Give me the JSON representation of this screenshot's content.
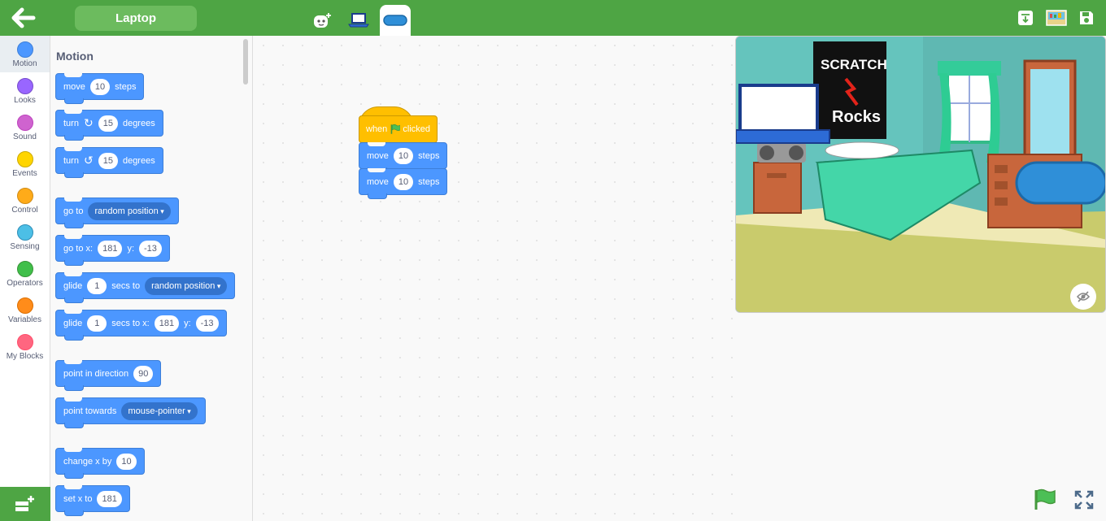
{
  "header": {
    "sprite_name": "Laptop",
    "back_icon": "arrow-left-icon",
    "tabs": [
      {
        "icon": "costume-icon",
        "name": "costumes-tab"
      },
      {
        "icon": "laptop-icon",
        "name": "laptop-sprite-tab"
      },
      {
        "icon": "code-blocks-icon",
        "name": "code-tab"
      }
    ],
    "right_icons": [
      "download-icon",
      "backdrop-icon",
      "save-icon"
    ]
  },
  "categories": [
    {
      "label": "Motion",
      "color": "#4c97ff"
    },
    {
      "label": "Looks",
      "color": "#9966ff"
    },
    {
      "label": "Sound",
      "color": "#cf63cf"
    },
    {
      "label": "Events",
      "color": "#ffd500"
    },
    {
      "label": "Control",
      "color": "#ffab19"
    },
    {
      "label": "Sensing",
      "color": "#4cbfe6"
    },
    {
      "label": "Operators",
      "color": "#40bf4a"
    },
    {
      "label": "Variables",
      "color": "#ff8c1a"
    },
    {
      "label": "My Blocks",
      "color": "#ff6680"
    }
  ],
  "palette": {
    "title": "Motion",
    "blocks": {
      "move": {
        "a": "move",
        "v": "10",
        "b": "steps"
      },
      "turn_cw": {
        "a": "turn",
        "v": "15",
        "b": "degrees"
      },
      "turn_ccw": {
        "a": "turn",
        "v": "15",
        "b": "degrees"
      },
      "goto": {
        "a": "go to",
        "d": "random position"
      },
      "gotoxy": {
        "a": "go to x:",
        "x": "181",
        "b": "y:",
        "y": "-13"
      },
      "glide": {
        "a": "glide",
        "v": "1",
        "b": "secs to",
        "d": "random position"
      },
      "glidexy": {
        "a": "glide",
        "v": "1",
        "b": "secs to x:",
        "x": "181",
        "c": "y:",
        "y": "-13"
      },
      "point_dir": {
        "a": "point in direction",
        "v": "90"
      },
      "point_towards": {
        "a": "point towards",
        "d": "mouse-pointer"
      },
      "change_x": {
        "a": "change x by",
        "v": "10"
      },
      "set_x": {
        "a": "set x to",
        "v": "181"
      }
    }
  },
  "workspace": {
    "hat": {
      "a": "when",
      "b": "clicked"
    },
    "move1": {
      "a": "move",
      "v": "10",
      "b": "steps"
    },
    "move2": {
      "a": "move",
      "v": "10",
      "b": "steps"
    }
  },
  "colors": {
    "topbar": "#4ea544",
    "motion": "#4c97ff",
    "events": "#ffbf00"
  }
}
